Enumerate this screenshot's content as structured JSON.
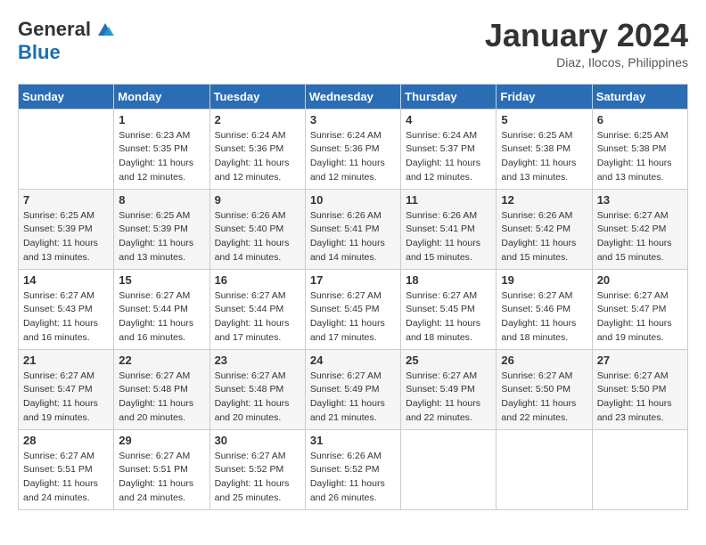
{
  "header": {
    "logo_general": "General",
    "logo_blue": "Blue",
    "month_title": "January 2024",
    "subtitle": "Diaz, Ilocos, Philippines"
  },
  "weekdays": [
    "Sunday",
    "Monday",
    "Tuesday",
    "Wednesday",
    "Thursday",
    "Friday",
    "Saturday"
  ],
  "weeks": [
    [
      {
        "day": "",
        "info": ""
      },
      {
        "day": "1",
        "info": "Sunrise: 6:23 AM\nSunset: 5:35 PM\nDaylight: 11 hours\nand 12 minutes."
      },
      {
        "day": "2",
        "info": "Sunrise: 6:24 AM\nSunset: 5:36 PM\nDaylight: 11 hours\nand 12 minutes."
      },
      {
        "day": "3",
        "info": "Sunrise: 6:24 AM\nSunset: 5:36 PM\nDaylight: 11 hours\nand 12 minutes."
      },
      {
        "day": "4",
        "info": "Sunrise: 6:24 AM\nSunset: 5:37 PM\nDaylight: 11 hours\nand 12 minutes."
      },
      {
        "day": "5",
        "info": "Sunrise: 6:25 AM\nSunset: 5:38 PM\nDaylight: 11 hours\nand 13 minutes."
      },
      {
        "day": "6",
        "info": "Sunrise: 6:25 AM\nSunset: 5:38 PM\nDaylight: 11 hours\nand 13 minutes."
      }
    ],
    [
      {
        "day": "7",
        "info": "Sunrise: 6:25 AM\nSunset: 5:39 PM\nDaylight: 11 hours\nand 13 minutes."
      },
      {
        "day": "8",
        "info": "Sunrise: 6:25 AM\nSunset: 5:39 PM\nDaylight: 11 hours\nand 13 minutes."
      },
      {
        "day": "9",
        "info": "Sunrise: 6:26 AM\nSunset: 5:40 PM\nDaylight: 11 hours\nand 14 minutes."
      },
      {
        "day": "10",
        "info": "Sunrise: 6:26 AM\nSunset: 5:41 PM\nDaylight: 11 hours\nand 14 minutes."
      },
      {
        "day": "11",
        "info": "Sunrise: 6:26 AM\nSunset: 5:41 PM\nDaylight: 11 hours\nand 15 minutes."
      },
      {
        "day": "12",
        "info": "Sunrise: 6:26 AM\nSunset: 5:42 PM\nDaylight: 11 hours\nand 15 minutes."
      },
      {
        "day": "13",
        "info": "Sunrise: 6:27 AM\nSunset: 5:42 PM\nDaylight: 11 hours\nand 15 minutes."
      }
    ],
    [
      {
        "day": "14",
        "info": "Sunrise: 6:27 AM\nSunset: 5:43 PM\nDaylight: 11 hours\nand 16 minutes."
      },
      {
        "day": "15",
        "info": "Sunrise: 6:27 AM\nSunset: 5:44 PM\nDaylight: 11 hours\nand 16 minutes."
      },
      {
        "day": "16",
        "info": "Sunrise: 6:27 AM\nSunset: 5:44 PM\nDaylight: 11 hours\nand 17 minutes."
      },
      {
        "day": "17",
        "info": "Sunrise: 6:27 AM\nSunset: 5:45 PM\nDaylight: 11 hours\nand 17 minutes."
      },
      {
        "day": "18",
        "info": "Sunrise: 6:27 AM\nSunset: 5:45 PM\nDaylight: 11 hours\nand 18 minutes."
      },
      {
        "day": "19",
        "info": "Sunrise: 6:27 AM\nSunset: 5:46 PM\nDaylight: 11 hours\nand 18 minutes."
      },
      {
        "day": "20",
        "info": "Sunrise: 6:27 AM\nSunset: 5:47 PM\nDaylight: 11 hours\nand 19 minutes."
      }
    ],
    [
      {
        "day": "21",
        "info": "Sunrise: 6:27 AM\nSunset: 5:47 PM\nDaylight: 11 hours\nand 19 minutes."
      },
      {
        "day": "22",
        "info": "Sunrise: 6:27 AM\nSunset: 5:48 PM\nDaylight: 11 hours\nand 20 minutes."
      },
      {
        "day": "23",
        "info": "Sunrise: 6:27 AM\nSunset: 5:48 PM\nDaylight: 11 hours\nand 20 minutes."
      },
      {
        "day": "24",
        "info": "Sunrise: 6:27 AM\nSunset: 5:49 PM\nDaylight: 11 hours\nand 21 minutes."
      },
      {
        "day": "25",
        "info": "Sunrise: 6:27 AM\nSunset: 5:49 PM\nDaylight: 11 hours\nand 22 minutes."
      },
      {
        "day": "26",
        "info": "Sunrise: 6:27 AM\nSunset: 5:50 PM\nDaylight: 11 hours\nand 22 minutes."
      },
      {
        "day": "27",
        "info": "Sunrise: 6:27 AM\nSunset: 5:50 PM\nDaylight: 11 hours\nand 23 minutes."
      }
    ],
    [
      {
        "day": "28",
        "info": "Sunrise: 6:27 AM\nSunset: 5:51 PM\nDaylight: 11 hours\nand 24 minutes."
      },
      {
        "day": "29",
        "info": "Sunrise: 6:27 AM\nSunset: 5:51 PM\nDaylight: 11 hours\nand 24 minutes."
      },
      {
        "day": "30",
        "info": "Sunrise: 6:27 AM\nSunset: 5:52 PM\nDaylight: 11 hours\nand 25 minutes."
      },
      {
        "day": "31",
        "info": "Sunrise: 6:26 AM\nSunset: 5:52 PM\nDaylight: 11 hours\nand 26 minutes."
      },
      {
        "day": "",
        "info": ""
      },
      {
        "day": "",
        "info": ""
      },
      {
        "day": "",
        "info": ""
      }
    ]
  ]
}
